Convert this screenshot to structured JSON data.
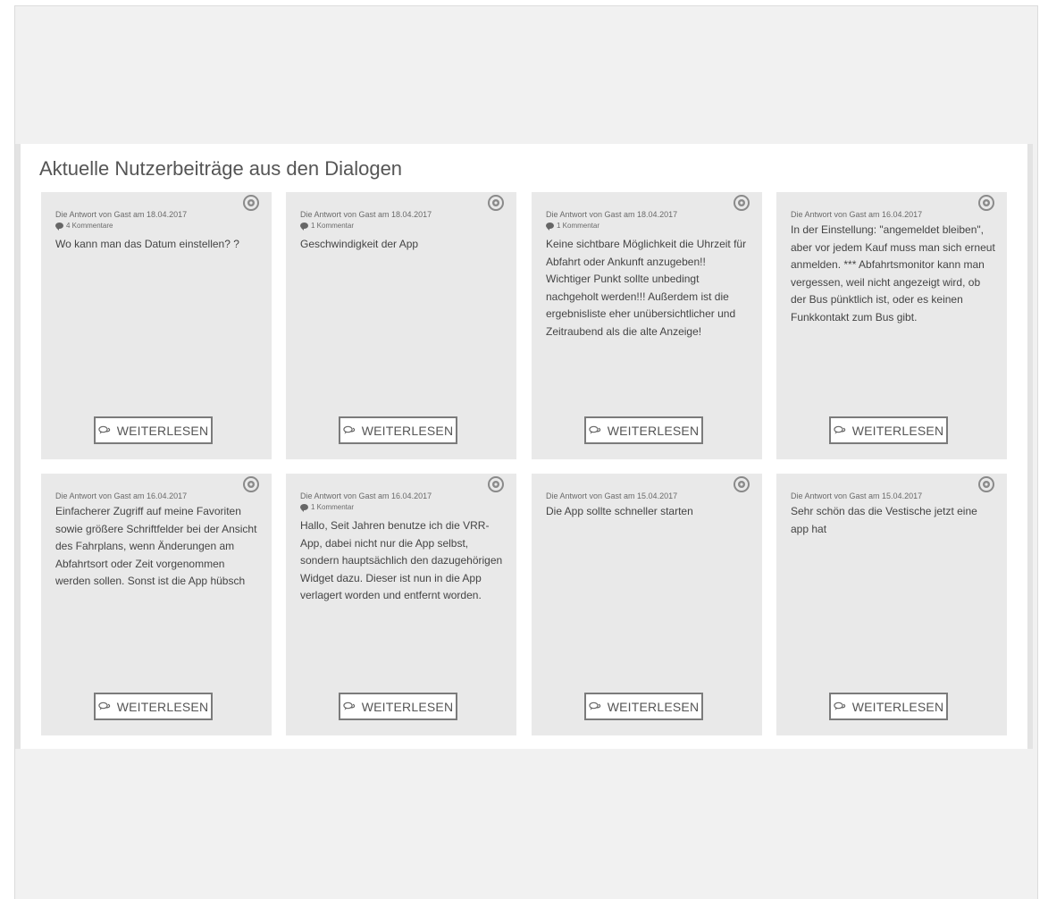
{
  "section": {
    "title": "Aktuelle Nutzerbeiträge aus den Dialogen"
  },
  "read_more_label": "WEITERLESEN",
  "cards": [
    {
      "meta": "Die Antwort von Gast am 18.04.2017",
      "comments": "4 Kommentare",
      "text": "Wo kann man das Datum einstellen? ?"
    },
    {
      "meta": "Die Antwort von Gast am 18.04.2017",
      "comments": "1 Kommentar",
      "text": "Geschwindigkeit der App"
    },
    {
      "meta": "Die Antwort von Gast am 18.04.2017",
      "comments": "1 Kommentar",
      "text": "Keine sichtbare Möglichkeit die Uhrzeit für Abfahrt oder Ankunft anzugeben!! Wichtiger Punkt sollte unbedingt nachgeholt werden!!! Außerdem ist die ergebnisliste eher unübersichtlicher und Zeitraubend als die alte Anzeige!"
    },
    {
      "meta": "Die Antwort von Gast am 16.04.2017",
      "comments": "",
      "text": "In der Einstellung: \"angemeldet bleiben\", aber vor jedem Kauf muss man sich erneut anmelden. *** Abfahrtsmonitor kann man vergessen, weil nicht angezeigt wird, ob der Bus pünktlich ist, oder es keinen Funkkontakt zum Bus gibt."
    },
    {
      "meta": "Die Antwort von Gast am 16.04.2017",
      "comments": "",
      "text": "Einfacherer Zugriff auf meine Favoriten sowie größere Schriftfelder bei der Ansicht des Fahrplans, wenn Änderungen am Abfahrtsort oder Zeit vorgenommen werden sollen. Sonst ist die App hübsch"
    },
    {
      "meta": "Die Antwort von Gast am 16.04.2017",
      "comments": "1 Kommentar",
      "text": "Hallo, Seit Jahren benutze ich die VRR-App, dabei nicht nur die App selbst, sondern hauptsächlich den dazugehörigen Widget dazu. Dieser ist nun in die App verlagert worden und entfernt worden."
    },
    {
      "meta": "Die Antwort von Gast am 15.04.2017",
      "comments": "",
      "text": "Die App sollte schneller starten"
    },
    {
      "meta": "Die Antwort von Gast am 15.04.2017",
      "comments": "",
      "text": "Sehr schön das die Vestische jetzt eine app hat"
    }
  ]
}
